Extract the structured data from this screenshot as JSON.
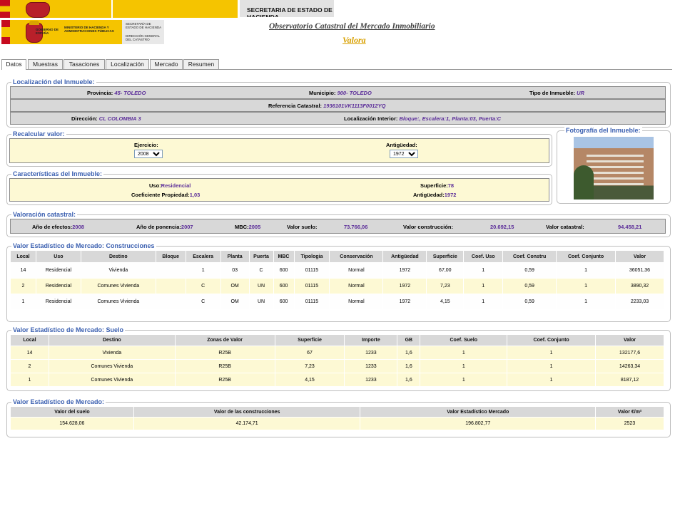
{
  "topbar": {
    "sec_label": "SECRETARIA DE ESTADO DE HACIENDA"
  },
  "logos": {
    "gobierno": "GOBIERNO DE ESPAÑA",
    "ministerio": "MINISTERIO DE HACIENDA Y ADMINISTRACIONES PÚBLICAS",
    "secretaria": "SECRETARÍA DE ESTADO DE HACIENDA",
    "direccion": "DIRECCIÓN GENERAL DEL CATASTRO"
  },
  "header": {
    "title": "Observatorio Catastral del Mercado Inmobiliario",
    "subtitle": "Valora"
  },
  "tabs": [
    {
      "label": "Datos",
      "active": true
    },
    {
      "label": "Muestras"
    },
    {
      "label": "Tasaciones"
    },
    {
      "label": "Localización"
    },
    {
      "label": "Mercado"
    },
    {
      "label": "Resumen"
    }
  ],
  "localizacion": {
    "title": "Localización del Inmueble:",
    "provincia_label": "Provincia:",
    "provincia": "45- TOLEDO",
    "municipio_label": "Municipio:",
    "municipio": "900- TOLEDO",
    "tipo_label": "Tipo de Inmueble:",
    "tipo": "UR",
    "referencia_label": "Referencia Catastral:",
    "referencia": "1936101VK1113F0012YQ",
    "direccion_label": "Dirección:",
    "direccion": "CL COLOMBIA 3",
    "loc_int_label": "Localización Interior:",
    "loc_int": "Bloque:, Escalera:1, Planta:03, Puerta:C"
  },
  "recalcular": {
    "title": "Recalcular valor:",
    "ejercicio_label": "Ejercicio:",
    "ejercicio": "2008",
    "antiguedad_label": "Antigüedad:",
    "antiguedad": "1972"
  },
  "foto": {
    "title": "Fotografía del Inmueble:"
  },
  "caracteristicas": {
    "title": "Características del Inmueble:",
    "uso_label": "Uso:",
    "uso": "Residencial",
    "superficie_label": "Superficie:",
    "superficie": "78",
    "coef_label": "Coeficiente Propiedad:",
    "coef": "1,03",
    "antiguedad_label": "Antigüedad:",
    "antiguedad": "1972"
  },
  "valoracion": {
    "title": "Valoración catastral:",
    "efectos_label": "Año de efectos:",
    "efectos": "2008",
    "ponencia_label": "Año de ponencia:",
    "ponencia": "2007",
    "mbc_label": "MBC:",
    "mbc": "2005",
    "suelo_label": "Valor suelo:",
    "suelo": "73.766,06",
    "construccion_label": "Valor construcción:",
    "construccion": "20.692,15",
    "catastral_label": "Valor catastral:",
    "catastral": "94.458,21"
  },
  "construcciones": {
    "title": "Valor Estadístico de Mercado: Construcciones",
    "headers": [
      "Local",
      "Uso",
      "Destino",
      "Bloque",
      "Escalera",
      "Planta",
      "Puerta",
      "MBC",
      "Tipologia",
      "Conservación",
      "Antigüedad",
      "Superficie",
      "Coef. Uso",
      "Coef. Constru",
      "Coef. Conjunto",
      "Valor"
    ],
    "rows": [
      [
        "14",
        "Residencial",
        "Vivienda",
        "",
        "1",
        "03",
        "C",
        "600",
        "01115",
        "Normal",
        "1972",
        "67,00",
        "1",
        "0,59",
        "1",
        "36051,36"
      ],
      [
        "2",
        "Residencial",
        "Comunes Vivienda",
        "",
        "C",
        "OM",
        "UN",
        "600",
        "01115",
        "Normal",
        "1972",
        "7,23",
        "1",
        "0,59",
        "1",
        "3890,32"
      ],
      [
        "1",
        "Residencial",
        "Comunes Vivienda",
        "",
        "C",
        "OM",
        "UN",
        "600",
        "01115",
        "Normal",
        "1972",
        "4,15",
        "1",
        "0,59",
        "1",
        "2233,03"
      ]
    ]
  },
  "suelo": {
    "title": "Valor Estadístico de Mercado: Suelo",
    "headers": [
      "Local",
      "Destino",
      "Zonas de Valor",
      "Superficie",
      "Importe",
      "GB",
      "Coef. Suelo",
      "Coef. Conjunto",
      "Valor"
    ],
    "rows": [
      [
        "14",
        "Vivienda",
        "R25B",
        "67",
        "1233",
        "1,6",
        "1",
        "1",
        "132177,6"
      ],
      [
        "2",
        "Comunes Vivienda",
        "R25B",
        "7,23",
        "1233",
        "1,6",
        "1",
        "1",
        "14263,34"
      ],
      [
        "1",
        "Comunes Vivienda",
        "R25B",
        "4,15",
        "1233",
        "1,6",
        "1",
        "1",
        "8187,12"
      ]
    ]
  },
  "mercado": {
    "title": "Valor Estadístico de Mercado:",
    "headers": [
      "Valor del suelo",
      "Valor de las construcciones",
      "Valor Estadístico Mercado",
      "Valor €/m²"
    ],
    "rows": [
      [
        "154.628,06",
        "42.174,71",
        "196.802,77",
        "2523"
      ]
    ]
  }
}
